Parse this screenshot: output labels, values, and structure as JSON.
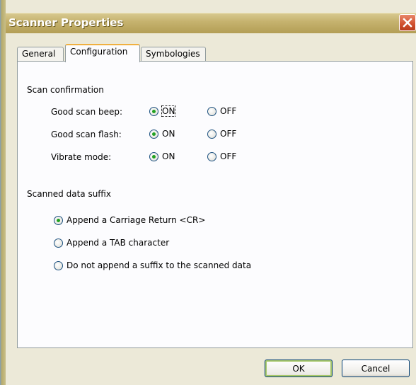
{
  "window": {
    "title": "Scanner Properties"
  },
  "tabs": [
    {
      "label": "General",
      "active": false
    },
    {
      "label": "Configuration",
      "active": true
    },
    {
      "label": "Symbologies",
      "active": false
    }
  ],
  "scan_confirmation": {
    "heading": "Scan confirmation",
    "rows": [
      {
        "label": "Good scan beep:",
        "on": "ON",
        "off": "OFF",
        "selected": "ON"
      },
      {
        "label": "Good scan flash:",
        "on": "ON",
        "off": "OFF",
        "selected": "ON"
      },
      {
        "label": "Vibrate mode:",
        "on": "ON",
        "off": "OFF",
        "selected": "ON"
      }
    ]
  },
  "suffix": {
    "heading": "Scanned data suffix",
    "options": [
      {
        "label": "Append a Carriage Return <CR>",
        "selected": true
      },
      {
        "label": "Append a TAB character",
        "selected": false
      },
      {
        "label": "Do not append a suffix to the scanned data",
        "selected": false
      }
    ]
  },
  "buttons": {
    "ok": "OK",
    "cancel": "Cancel"
  },
  "colors": {
    "radio_dot": "#21a121",
    "tab_highlight": "#f0b040",
    "title_bar": "#c6b36f"
  }
}
